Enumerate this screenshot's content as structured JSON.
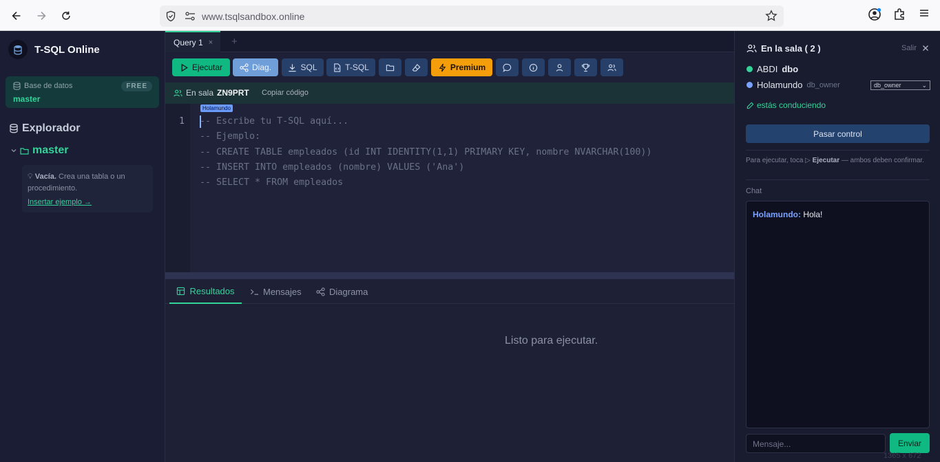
{
  "browser": {
    "url": "www.tsqlsandbox.online"
  },
  "sidebar": {
    "app_name": "T-SQL Online",
    "db_label": "Base de datos",
    "db_value": "master",
    "db_badge": "FREE",
    "explorer_title": "Explorador",
    "tree_db": "master",
    "empty_bold": "Vacía.",
    "empty_text": " Crea una tabla o un procedimiento.",
    "insert_link": "Insertar ejemplo →"
  },
  "editor_tabs": [
    {
      "label": "Query 1",
      "close": "×"
    }
  ],
  "tab_add": "+",
  "toolbar": {
    "run": "Ejecutar",
    "diag": "Diag.",
    "sql": "SQL",
    "tsql": "T-SQL",
    "premium": "Premium"
  },
  "roombar": {
    "label": "En sala",
    "code": "ZN9PRT",
    "copy": "Copiar código"
  },
  "editor": {
    "cursor_user": "Holamundo",
    "line_number": "1",
    "lines": [
      "-- Escribe tu T-SQL aquí...",
      "-- Ejemplo:",
      "-- CREATE TABLE empleados (id INT IDENTITY(1,1) PRIMARY KEY, nombre NVARCHAR(100))",
      "-- INSERT INTO empleados (nombre) VALUES ('Ana')",
      "-- SELECT * FROM empleados"
    ]
  },
  "results": {
    "tabs": [
      "Resultados",
      "Mensajes",
      "Diagrama"
    ],
    "active_tab": "Resultados",
    "status": "Listo para ejecutar."
  },
  "room": {
    "title": "En la sala ( 2 )",
    "leave": "Salir",
    "members": [
      {
        "name": "ABDI",
        "role": "dbo",
        "color": "#34d399"
      },
      {
        "name": "Holamundo",
        "role": "db_owner",
        "color": "#7aa2ff"
      }
    ],
    "role_select": "db_owner",
    "driving": "estás conduciendo",
    "pass_control": "Pasar control",
    "hint_prefix": "Para ejecutar, toca ▷ ",
    "hint_bold": "Ejecutar",
    "hint_suffix": " — ambos deben confirmar.",
    "chat_label": "Chat",
    "chat_messages": [
      {
        "author": "Holamundo:",
        "text": " Hola!"
      }
    ],
    "message_placeholder": "Mensaje...",
    "send": "Enviar"
  },
  "overlay_dims": "1365 x 672",
  "colors": {
    "accent": "#34d399",
    "premium": "#f59e0b",
    "diag": "#6f9ed9",
    "cursor": "#7aa2ff"
  }
}
